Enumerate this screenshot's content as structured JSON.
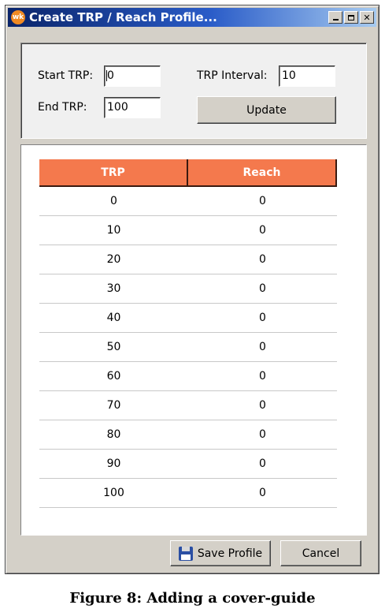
{
  "window": {
    "app_icon_text": "wk",
    "title": "Create TRP / Reach Profile...",
    "close_glyph": "✕"
  },
  "form": {
    "start_trp_label": "Start TRP:",
    "start_trp_value": "0",
    "end_trp_label": "End TRP:",
    "end_trp_value": "100",
    "trp_interval_label": "TRP Interval:",
    "trp_interval_value": "10",
    "update_label": "Update"
  },
  "table": {
    "header_color": "#f4794d",
    "columns": [
      "TRP",
      "Reach"
    ],
    "rows": [
      [
        "0",
        "0"
      ],
      [
        "10",
        "0"
      ],
      [
        "20",
        "0"
      ],
      [
        "30",
        "0"
      ],
      [
        "40",
        "0"
      ],
      [
        "50",
        "0"
      ],
      [
        "60",
        "0"
      ],
      [
        "70",
        "0"
      ],
      [
        "80",
        "0"
      ],
      [
        "90",
        "0"
      ],
      [
        "100",
        "0"
      ]
    ]
  },
  "footer": {
    "save_profile_label": "Save Profile",
    "save_icon": "floppy-disk-icon",
    "cancel_label": "Cancel"
  },
  "caption": "Figure 8: Adding a cover-guide"
}
